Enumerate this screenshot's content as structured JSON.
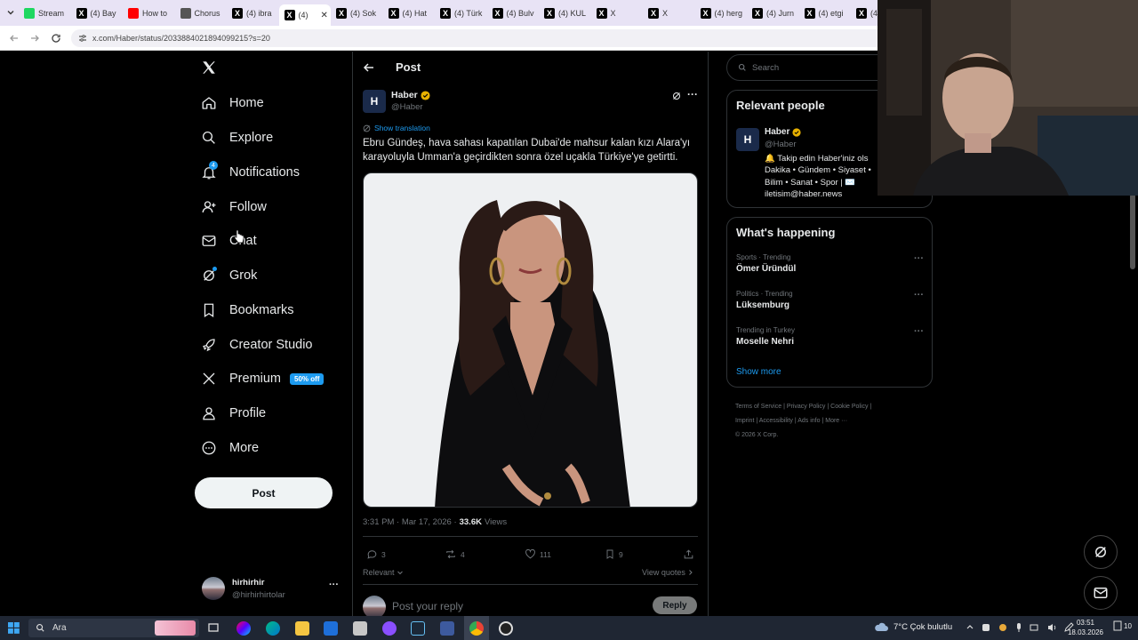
{
  "browser": {
    "tabs": [
      {
        "label": "Stream",
        "color": "#1ed760"
      },
      {
        "label": "(4) Bay",
        "color": "#000000"
      },
      {
        "label": "How to",
        "color": "#ff0000"
      },
      {
        "label": "Chorus",
        "color": "#555555"
      },
      {
        "label": "(4) ibra",
        "color": "#000000"
      },
      {
        "label": "(4)",
        "color": "#000000"
      },
      {
        "label": "(4) Sok",
        "color": "#000000"
      },
      {
        "label": "(4) Hat",
        "color": "#000000"
      },
      {
        "label": "(4) Türk",
        "color": "#000000"
      },
      {
        "label": "(4) Bulv",
        "color": "#000000"
      },
      {
        "label": "(4) KUL",
        "color": "#000000"
      },
      {
        "label": "X",
        "color": "#000000"
      },
      {
        "label": "X",
        "color": "#000000"
      },
      {
        "label": "(4) herg",
        "color": "#000000"
      },
      {
        "label": "(4) Jurn",
        "color": "#000000"
      },
      {
        "label": "(4) etgi",
        "color": "#000000"
      },
      {
        "label": "(4",
        "color": "#000000"
      }
    ],
    "url": "x.com/Haber/status/2033884021894099215?s=20"
  },
  "sidebar": {
    "logo": "X",
    "items": [
      {
        "label": "Home",
        "icon": "home-icon"
      },
      {
        "label": "Explore",
        "icon": "search-icon"
      },
      {
        "label": "Notifications",
        "icon": "bell-icon",
        "badge": "4"
      },
      {
        "label": "Follow",
        "icon": "person-add-icon"
      },
      {
        "label": "Chat",
        "icon": "mail-icon"
      },
      {
        "label": "Grok",
        "icon": "grok-icon"
      },
      {
        "label": "Bookmarks",
        "icon": "bookmark-icon"
      },
      {
        "label": "Creator Studio",
        "icon": "rocket-icon"
      },
      {
        "label": "Premium",
        "icon": "x-icon",
        "badge": "50% off"
      },
      {
        "label": "Profile",
        "icon": "person-icon"
      },
      {
        "label": "More",
        "icon": "more-circle-icon"
      }
    ],
    "post_label": "Post",
    "account": {
      "name": "hirhirhir",
      "handle": "@hirhirhirtolar",
      "more": "···"
    }
  },
  "post": {
    "header_title": "Post",
    "author_name": "Haber",
    "author_handle": "@Haber",
    "avatar_letter": "H",
    "show_translation": "Show translation",
    "text": "Ebru Gündeş, hava sahası kapatılan Dubai'de mahsur kalan kızı Alara'yı karayoluyla Umman'a geçirdikten sonra özel uçakla Türkiye'ye getirtti.",
    "time": "3:31 PM · Mar 17, 2026 ·",
    "views_count": "33.6K",
    "views_label": "Views",
    "replies": "3",
    "reposts": "4",
    "likes": "111",
    "bookmarks": "9",
    "relevant_label": "Relevant",
    "view_quotes": "View quotes",
    "reply_placeholder": "Post your reply",
    "reply_button": "Reply"
  },
  "right": {
    "search_placeholder": "Search",
    "relevant_title": "Relevant people",
    "person": {
      "name": "Haber",
      "handle": "@Haber",
      "bio": "🔔 Takip edin Haber'iniz ols Dakika • Gündem • Siyaset • Bilim • Sanat • Spor | ✉️ iletisim@haber.news"
    },
    "happening_title": "What's happening",
    "trends": [
      {
        "category": "Sports · Trending",
        "name": "Ömer Üründül"
      },
      {
        "category": "Politics · Trending",
        "name": "Lüksemburg"
      },
      {
        "category": "Trending in Turkey",
        "name": "Moselle Nehri"
      }
    ],
    "show_more": "Show more",
    "footer_line1": [
      "Terms of Service",
      "Privacy Policy",
      "Cookie Policy"
    ],
    "footer_line2": [
      "Imprint",
      "Accessibility",
      "Ads info",
      "More ···"
    ],
    "copyright": "© 2026 X Corp."
  },
  "taskbar": {
    "search": "Ara",
    "weather": "7°C  Çok bulutlu",
    "time": "03:51",
    "date": "18.03.2026",
    "notif_count": "10"
  },
  "colors": {
    "accent": "#1d9bf0",
    "verified": "#e8b100"
  }
}
